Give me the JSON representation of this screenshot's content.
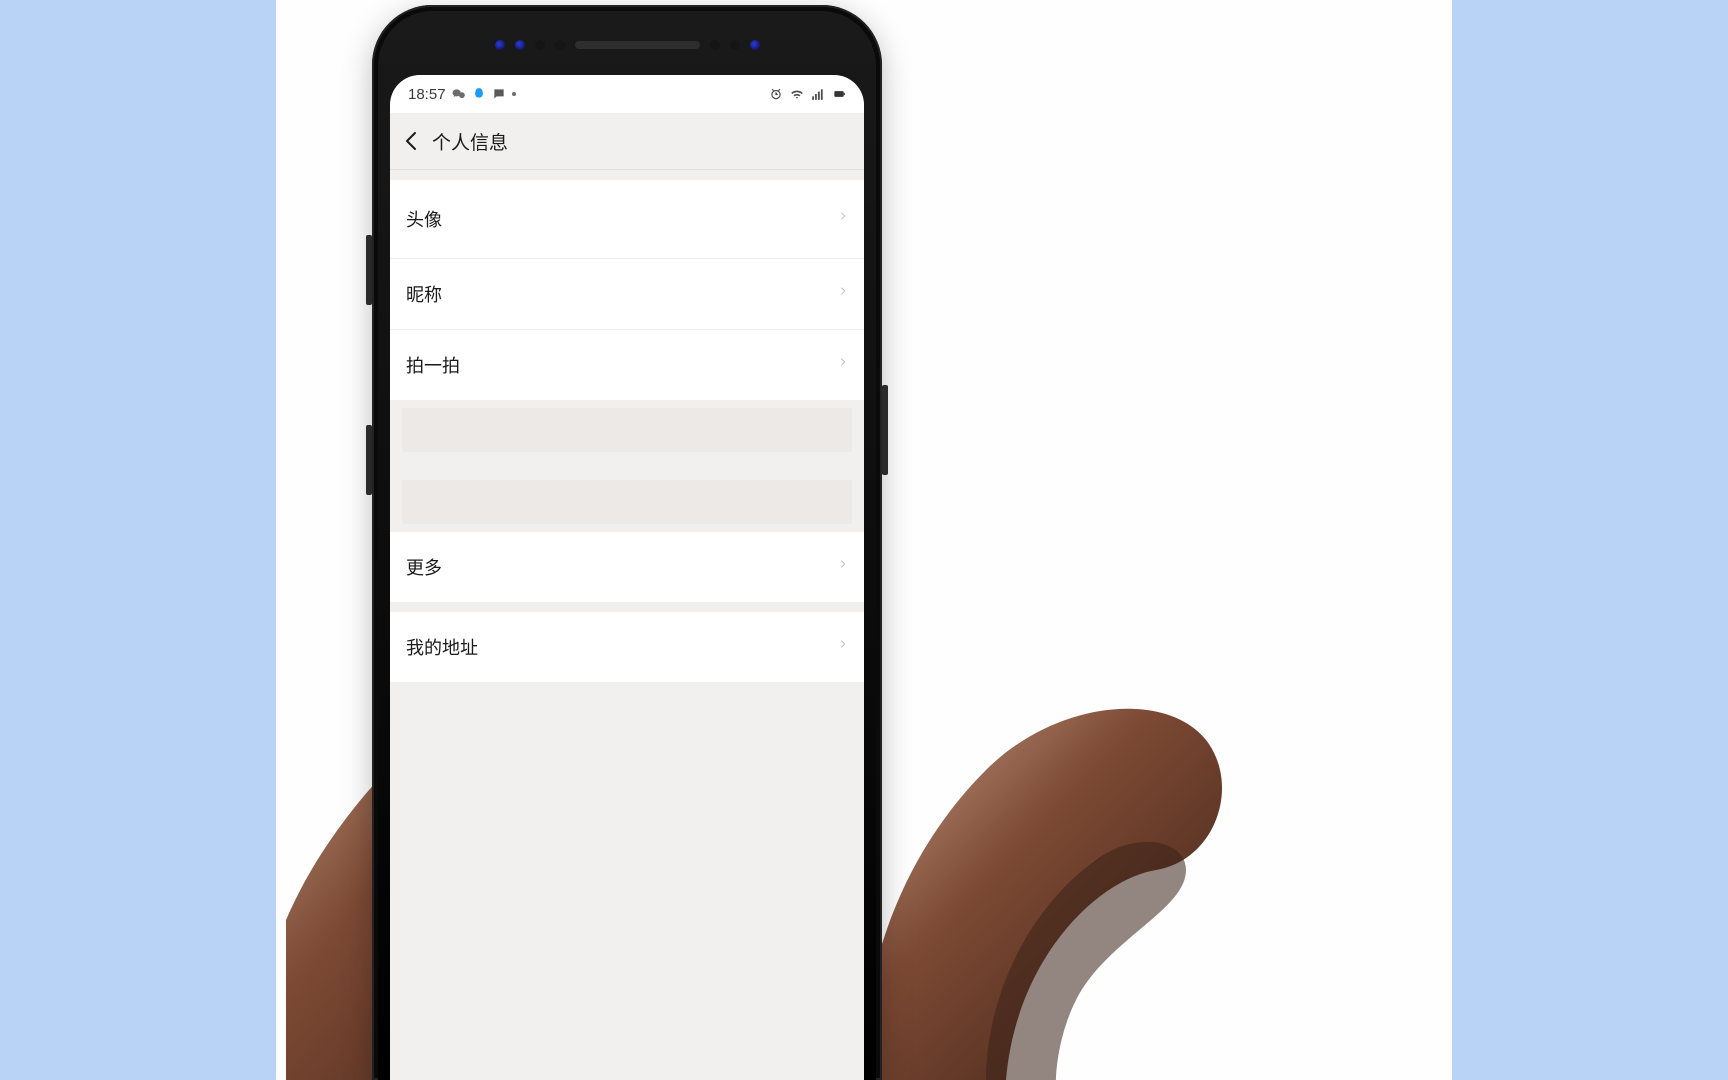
{
  "status_bar": {
    "time": "18:57",
    "icons_left": [
      "wechat-icon",
      "qq-icon",
      "chat-bubble-icon",
      "more-dot-icon"
    ],
    "icons_right": [
      "alarm-icon",
      "wifi-icon",
      "signal-icon",
      "battery-icon"
    ]
  },
  "nav": {
    "title": "个人信息"
  },
  "sections": {
    "group1": [
      {
        "label": "头像"
      },
      {
        "label": "昵称"
      },
      {
        "label": "拍一拍"
      }
    ],
    "group2": [
      {
        "label": "更多"
      }
    ],
    "group3": [
      {
        "label": "我的地址"
      }
    ]
  }
}
